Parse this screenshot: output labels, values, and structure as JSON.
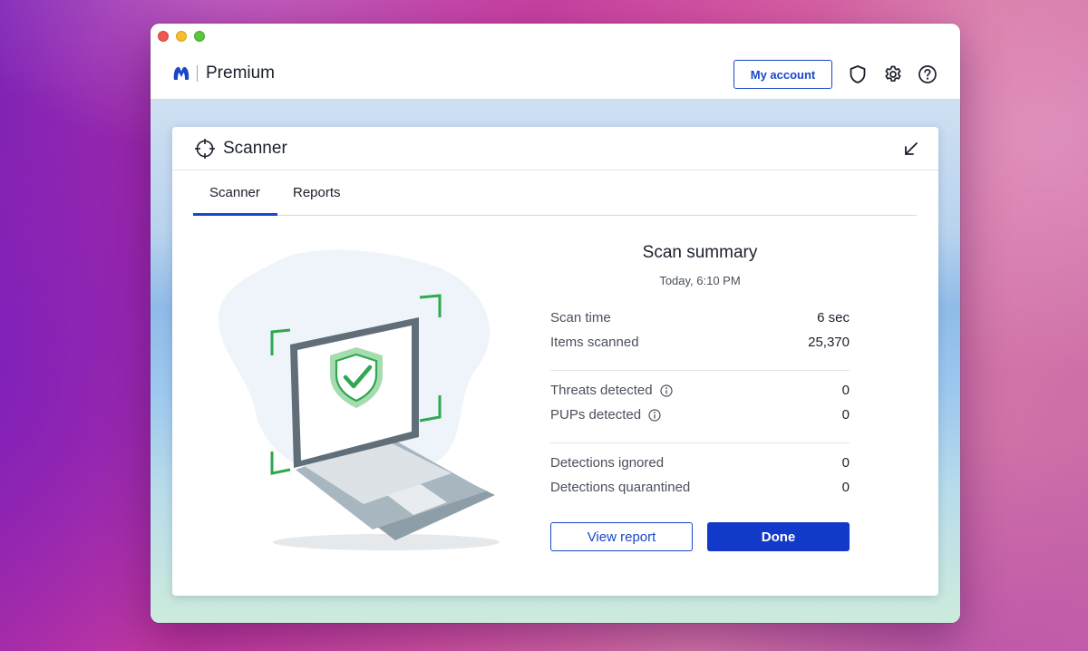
{
  "app": {
    "brand_title": "Premium",
    "my_account_label": "My account"
  },
  "panel": {
    "title": "Scanner",
    "tabs": [
      {
        "label": "Scanner",
        "active": true
      },
      {
        "label": "Reports",
        "active": false
      }
    ]
  },
  "summary": {
    "title": "Scan summary",
    "date": "Today, 6:10 PM",
    "rows": [
      {
        "label": "Scan time",
        "value": "6 sec"
      },
      {
        "label": "Items scanned",
        "value": "25,370"
      },
      {
        "label": "Threats detected",
        "value": "0"
      },
      {
        "label": "PUPs detected",
        "value": "0"
      },
      {
        "label": "Detections ignored",
        "value": "0"
      },
      {
        "label": "Detections quarantined",
        "value": "0"
      }
    ],
    "view_report_label": "View report",
    "done_label": "Done"
  },
  "icons": [
    "malwarebytes-logo-icon",
    "shield-icon",
    "gear-icon",
    "help-icon",
    "crosshair-icon",
    "minimize-icon",
    "info-icon",
    "laptop-shield-illustration"
  ],
  "colors": {
    "accent": "#1a47c8",
    "primary_button": "#1239c8",
    "check_green": "#2fa84f"
  }
}
